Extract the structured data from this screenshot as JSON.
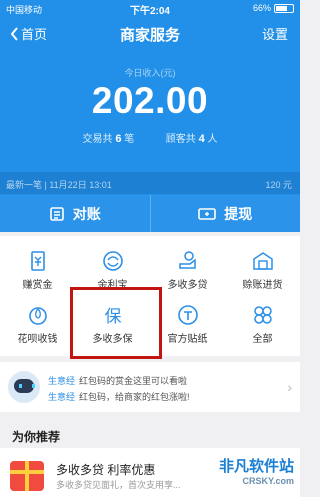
{
  "status": {
    "carrier": "中国移动",
    "time": "下午2:04",
    "battery": "66%"
  },
  "nav": {
    "back": "首页",
    "title": "商家服务",
    "settings": "设置"
  },
  "summary": {
    "income_label": "今日收入(元)",
    "income": "202.00",
    "trans_prefix": "交易共",
    "trans_count": "6",
    "trans_unit": "笔",
    "cust_prefix": "顾客共",
    "cust_count": "4",
    "cust_unit": "人"
  },
  "latest": {
    "text": "最新一笔 | 11月22日 13:01",
    "amount": "120 元"
  },
  "actions": {
    "reconcile": "对账",
    "withdraw": "提现"
  },
  "services": [
    {
      "label": "赚赏金",
      "icon": "money-tag-icon"
    },
    {
      "label": "余利宝",
      "icon": "yulibao-icon"
    },
    {
      "label": "多收多贷",
      "icon": "loan-icon"
    },
    {
      "label": "赊账进货",
      "icon": "stock-icon"
    },
    {
      "label": "花呗收钱",
      "icon": "huabei-icon"
    },
    {
      "label": "多收多保",
      "icon": "insurance-icon"
    },
    {
      "label": "官方贴纸",
      "icon": "sticker-icon"
    },
    {
      "label": "全部",
      "icon": "all-icon"
    }
  ],
  "promo": {
    "tag": "生意经",
    "line1": "红包码的赏金这里可以看啦",
    "line2": "红包码，给商家的红包涨啦!"
  },
  "recommend": {
    "title": "为你推荐",
    "item_name": "多收多贷 利率优惠",
    "item_desc": "多收多贷见面礼，首次支用享..."
  },
  "watermark": {
    "line1": "非凡软件站",
    "line2": "CRSKY.com"
  },
  "colors": {
    "primary": "#2290e8",
    "highlight": "#c3150f"
  }
}
